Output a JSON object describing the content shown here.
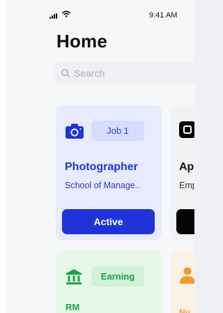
{
  "status_bar": {
    "time": "9:41 AM"
  },
  "header": {
    "title": "Home"
  },
  "search": {
    "placeholder": "Search"
  },
  "cards": {
    "job": {
      "tag": "Job 1",
      "title": "Photographer",
      "subtitle": "School of Manage..",
      "button": "Active",
      "accent": "#1f33d9",
      "icon": "camera-icon"
    },
    "application": {
      "title": "Ap",
      "subtitle": "Emp",
      "icon": "app-logo-icon"
    },
    "earning": {
      "tag": "Earning",
      "currency": "RM",
      "accent": "#1aa544",
      "icon": "bank-icon"
    },
    "partial_orange": {
      "label": "Nu",
      "accent": "#f39a2a",
      "icon": "person-icon"
    }
  }
}
